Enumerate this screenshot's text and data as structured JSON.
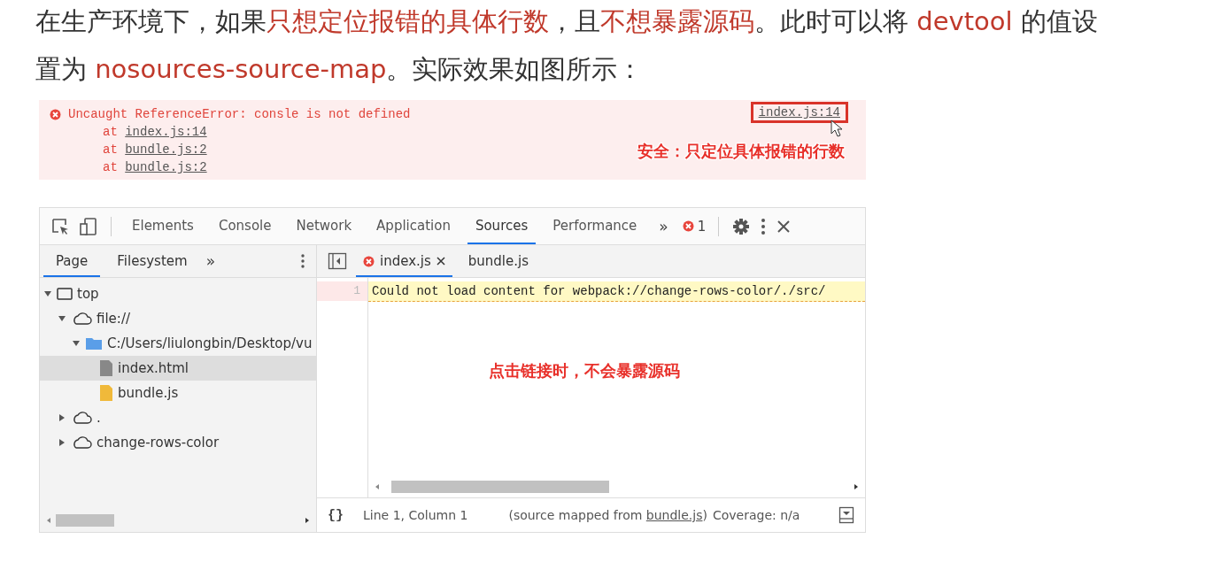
{
  "intro": {
    "segments": [
      {
        "text": "在生产环境下，如果",
        "highlight": false
      },
      {
        "text": "只想定位报错的具体行数",
        "highlight": true
      },
      {
        "text": "，且",
        "highlight": false
      },
      {
        "text": "不想暴露源码",
        "highlight": true
      },
      {
        "text": "。此时可以将 ",
        "highlight": false
      },
      {
        "text": "devtool",
        "highlight": true
      },
      {
        "text": " 的值设置为 ",
        "highlight": false
      },
      {
        "text": "nosources-source-map",
        "highlight": true
      },
      {
        "text": "。实际效果如图所示：",
        "highlight": false
      }
    ]
  },
  "error_panel": {
    "message": "Uncaught ReferenceError: consle is not defined",
    "location_link": "index.js:14",
    "stack": [
      {
        "prefix": "at ",
        "link": "index.js:14"
      },
      {
        "prefix": "at ",
        "link": "bundle.js:2"
      },
      {
        "prefix": "at ",
        "link": "bundle.js:2"
      }
    ],
    "annotation": "安全：只定位具体报错的行数"
  },
  "devtools": {
    "tabs": [
      {
        "label": "Elements",
        "selected": false
      },
      {
        "label": "Console",
        "selected": false
      },
      {
        "label": "Network",
        "selected": false
      },
      {
        "label": "Application",
        "selected": false
      },
      {
        "label": "Sources",
        "selected": true
      },
      {
        "label": "Performance",
        "selected": false
      }
    ],
    "more_tabs": "»",
    "error_count": "1",
    "navigator_tabs": [
      {
        "label": "Page",
        "selected": true
      },
      {
        "label": "Filesystem",
        "selected": false
      }
    ],
    "navigator_more": "»",
    "tree": [
      {
        "label": "top",
        "kind": "frame",
        "expanded": true,
        "selected": false,
        "children": [
          {
            "label": "file://",
            "kind": "cloud",
            "expanded": true,
            "selected": false,
            "children": [
              {
                "label": "C:/Users/liulongbin/Desktop/vu",
                "kind": "folder",
                "expanded": true,
                "selected": false,
                "children": [
                  {
                    "label": "index.html",
                    "kind": "doc",
                    "selected": true
                  },
                  {
                    "label": "bundle.js",
                    "kind": "script",
                    "selected": false
                  }
                ]
              }
            ]
          },
          {
            "label": ".",
            "kind": "cloud",
            "expanded": false,
            "selected": false
          },
          {
            "label": "change-rows-color",
            "kind": "cloud",
            "expanded": false,
            "selected": false
          }
        ]
      }
    ],
    "editor_tabs": [
      {
        "label": "index.js",
        "selected": true,
        "error": true,
        "closable": true
      },
      {
        "label": "bundle.js",
        "selected": false,
        "error": false,
        "closable": false
      }
    ],
    "code_lines": [
      {
        "number": "1",
        "text": "Could not load content for webpack://change-rows-color/./src/"
      }
    ],
    "annotation": "点击链接时，不会暴露源码",
    "status": {
      "pretty_print": "{}",
      "position": "Line 1, Column 1",
      "mapped_prefix": "(source mapped from ",
      "mapped_link": "bundle.js",
      "mapped_suffix": ")",
      "coverage": "Coverage: n/a"
    }
  }
}
